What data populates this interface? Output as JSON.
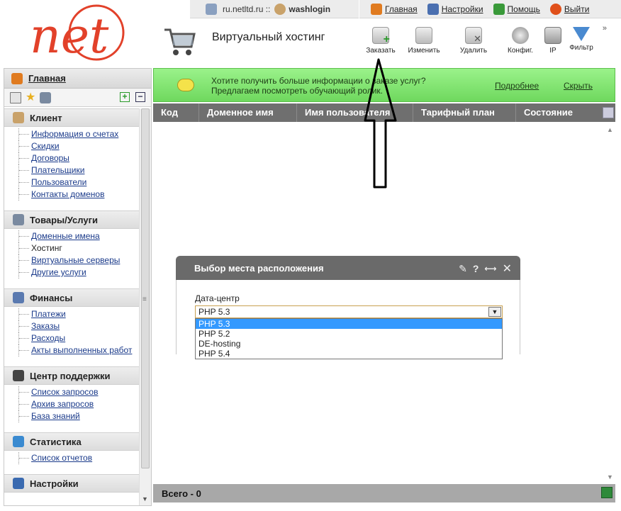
{
  "topbar": {
    "server": "ru.netltd.ru ::",
    "user": "washlogin",
    "links": [
      {
        "label": "Главная",
        "icon": "home-icon",
        "color": "#e07b20"
      },
      {
        "label": "Настройки",
        "icon": "settings-icon",
        "color": "#4a6fb0"
      },
      {
        "label": "Помощь",
        "icon": "help-icon",
        "color": "#3a9a3a"
      },
      {
        "label": "Выйти",
        "icon": "power-icon",
        "color": "#e0501a"
      }
    ]
  },
  "header": {
    "title": "Виртуальный хостинг",
    "toolbar": [
      {
        "label": "Заказать",
        "icon": "add-doc-icon"
      },
      {
        "label": "Изменить",
        "icon": "edit-doc-icon"
      },
      {
        "label": "Удалить",
        "icon": "delete-doc-icon"
      },
      {
        "label": "Конфиг.",
        "icon": "config-icon"
      },
      {
        "label": "IP",
        "icon": "ip-icon"
      },
      {
        "label": "Фильтр",
        "icon": "filter-icon"
      }
    ],
    "more": "»"
  },
  "sidebar": {
    "home": "Главная",
    "sections": [
      {
        "title": "Клиент",
        "icon": "user-icon",
        "items": [
          "Информация о счетах",
          "Скидки",
          "Договоры",
          "Плательщики",
          "Пользователи",
          "Контакты доменов"
        ]
      },
      {
        "title": "Товары/Услуги",
        "icon": "cart-icon",
        "items": [
          "Доменные имена",
          "Хостинг",
          "Виртуальные серверы",
          "Другие услуги"
        ]
      },
      {
        "title": "Финансы",
        "icon": "finance-icon",
        "items": [
          "Платежи",
          "Заказы",
          "Расходы",
          "Акты выполненных работ"
        ]
      },
      {
        "title": "Центр поддержки",
        "icon": "headset-icon",
        "items": [
          "Список запросов",
          "Архив запросов",
          "База знаний"
        ]
      },
      {
        "title": "Статистика",
        "icon": "chart-icon",
        "items": [
          "Список отчетов"
        ]
      },
      {
        "title": "Настройки",
        "icon": "monitor-icon",
        "items": []
      }
    ]
  },
  "banner": {
    "line1": "Хотите получить больше информации о заказе услуг?",
    "line2": "Предлагаем посмотреть обучающий ролик.",
    "more": "Подробнее",
    "hide": "Скрыть"
  },
  "grid": {
    "columns": [
      "Код",
      "Доменное имя",
      "Имя пользователя",
      "Тарифный план",
      "Состояние"
    ],
    "footer": "Всего - 0"
  },
  "dialog": {
    "title": "Выбор места расположения",
    "field_label": "Дата-центр",
    "selected": "PHP 5.3",
    "options": [
      "PHP 5.3",
      "PHP 5.2",
      "DE-hosting",
      "PHP 5.4"
    ]
  }
}
